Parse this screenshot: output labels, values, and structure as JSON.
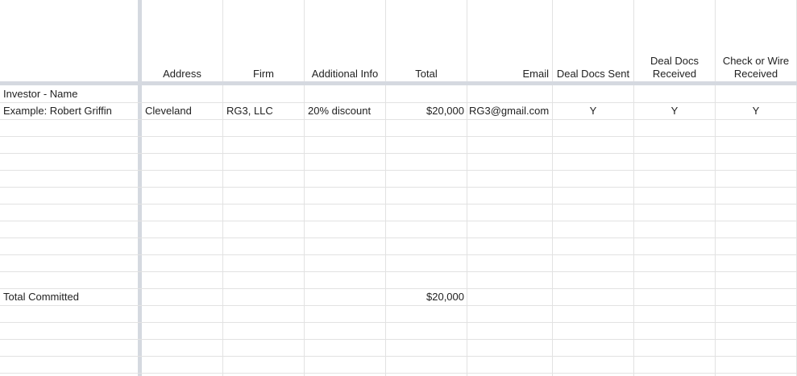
{
  "headers": {
    "address": "Address",
    "firm": "Firm",
    "additional_info": "Additional Info",
    "total": "Total",
    "email": "Email",
    "deal_docs_sent": "Deal Docs Sent",
    "deal_docs_received_line1": "Deal Docs",
    "deal_docs_received_line2": "Received",
    "check_or_wire_line1": "Check or Wire",
    "check_or_wire_line2": "Received"
  },
  "rows": {
    "investor_label": "Investor - Name",
    "example": {
      "name": "Example: Robert Griffin",
      "address": "Cleveland",
      "firm": "RG3, LLC",
      "additional_info": "20% discount",
      "total": "$20,000",
      "email": "RG3@gmail.com",
      "deal_docs_sent": "Y",
      "deal_docs_received": "Y",
      "check_or_wire_received": "Y"
    },
    "total_committed": {
      "label": "Total Committed",
      "total": "$20,000"
    }
  }
}
